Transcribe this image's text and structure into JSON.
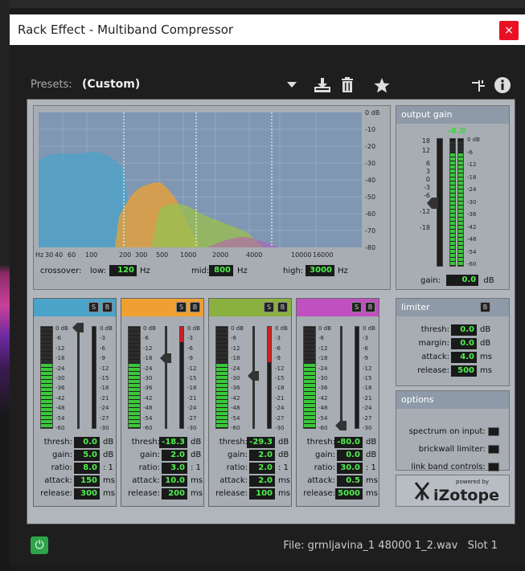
{
  "window": {
    "title": "Rack Effect - Multiband Compressor",
    "close_label": "×"
  },
  "presets": {
    "label": "Presets:",
    "value": "(Custom)"
  },
  "icons": {
    "save": "download-icon",
    "delete": "trash-icon",
    "favorite": "star-icon",
    "routing": "routing-icon",
    "info": "info-icon"
  },
  "graph": {
    "db_ticks": [
      "0 dB",
      "-10",
      "-20",
      "-30",
      "-40",
      "-50",
      "-60",
      "-70",
      "-80"
    ],
    "freq_ticks": [
      "Hz",
      "30",
      "40",
      "60",
      "100",
      "200",
      "300",
      "500",
      "1000",
      "2000",
      "4000",
      "10000",
      "16000"
    ],
    "crossover_label": "crossover:",
    "low_label": "low:",
    "low_value": "120",
    "low_unit": "Hz",
    "mid_label": "mid:",
    "mid_value": "800",
    "mid_unit": "Hz",
    "high_label": "high:",
    "high_value": "3000",
    "high_unit": "Hz"
  },
  "output_gain": {
    "title": "output gain",
    "readout": "-8.0",
    "scale_left": [
      "18",
      "12",
      "6",
      "3",
      "0",
      "-3",
      "-6",
      "-12",
      "-18"
    ],
    "scale_right": [
      "0 dB",
      "-6",
      "-12",
      "-18",
      "-24",
      "-30",
      "-36",
      "-42",
      "-48",
      "-54",
      "-60"
    ],
    "gain_label": "gain:",
    "gain_value": "0.0",
    "gain_unit": "dB"
  },
  "meter_scale_in": [
    "0 dB",
    "-6",
    "-12",
    "-18",
    "-24",
    "-30",
    "-36",
    "-42",
    "-48",
    "-54",
    "-60"
  ],
  "meter_scale_gr": [
    "0 dB",
    "-3",
    "-6",
    "-9",
    "-12",
    "-15",
    "-18",
    "-21",
    "-24",
    "-27",
    "-30"
  ],
  "band_labels": {
    "thresh": "thresh:",
    "gain": "gain:",
    "ratio": "ratio:",
    "attack": "attack:",
    "release": "release:",
    "db": "dB",
    "ms": "ms",
    "ratio_unit": ": 1",
    "solo": "S",
    "bypass": "B"
  },
  "bands": [
    {
      "color": "#4aa3c8",
      "thresh": "0.0",
      "gain": "5.0",
      "ratio": "8.0",
      "attack": "150",
      "release": "300"
    },
    {
      "color": "#f0a030",
      "thresh": "-18.3",
      "gain": "2.0",
      "ratio": "3.0",
      "attack": "10.0",
      "release": "200"
    },
    {
      "color": "#8ab040",
      "thresh": "-29.3",
      "gain": "2.0",
      "ratio": "2.0",
      "attack": "2.0",
      "release": "100"
    },
    {
      "color": "#c050c0",
      "thresh": "-80.0",
      "gain": "0.0",
      "ratio": "30.0",
      "attack": "0.5",
      "release": "5000"
    }
  ],
  "limiter": {
    "title": "limiter",
    "thresh_label": "thresh:",
    "thresh": "0.0",
    "thresh_unit": "dB",
    "margin_label": "margin:",
    "margin": "0.0",
    "margin_unit": "dB",
    "attack_label": "attack:",
    "attack": "4.0",
    "attack_unit": "ms",
    "release_label": "release:",
    "release": "500",
    "release_unit": "ms"
  },
  "options": {
    "title": "options",
    "spectrum": "spectrum on input:",
    "brickwall": "brickwall limiter:",
    "link": "link band controls:"
  },
  "brand": {
    "powered": "powered by",
    "name": "iZotope"
  },
  "footer": {
    "file": "File: grmljavina_1 48000 1_2.wav",
    "slot": "Slot 1"
  }
}
